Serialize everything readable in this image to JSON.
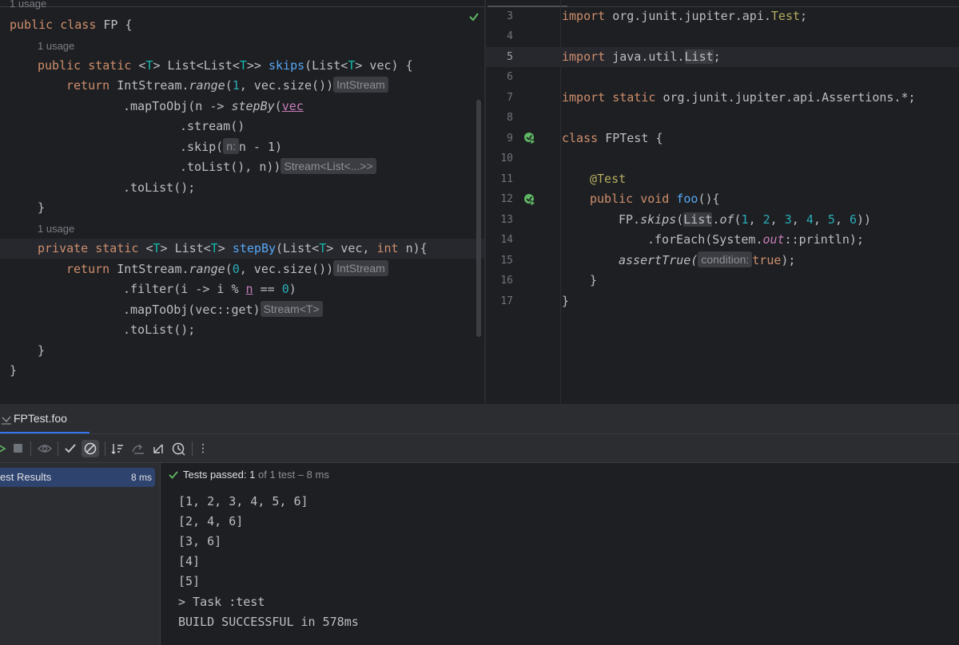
{
  "left_editor": {
    "usage_top": "1 usage",
    "class_line": "public class FP {",
    "usage_skips": "1 usage",
    "skips": {
      "line1": "public static <T> List<List<T>> skips(List<T> vec) {",
      "line2": "return IntStream.range(1, vec.size())",
      "hint2": "IntStream",
      "line3": ".mapToObj(n -> stepBy(vec",
      "line4": ".stream()",
      "line5a": ".skip(",
      "hint5": "n:",
      "line5b": "n - 1)",
      "line6": ".toList(), n))",
      "hint6": "Stream<List<...>>",
      "line7": ".toList();",
      "close": "}"
    },
    "usage_stepby": "1 usage",
    "stepby": {
      "line1": "private static <T> List<T> stepBy(List<T> vec, int n){",
      "line2": "return IntStream.range(0, vec.size())",
      "hint2": "IntStream",
      "line3": ".filter(i -> i % n == 0)",
      "line4": ".mapToObj(vec::get)",
      "hint4": "Stream<T>",
      "line5": ".toList();",
      "close": "}"
    },
    "class_close": "}"
  },
  "right_editor": {
    "line_numbers": [
      "3",
      "4",
      "5",
      "6",
      "7",
      "8",
      "9",
      "10",
      "11",
      "12",
      "13",
      "14",
      "15",
      "16",
      "17"
    ],
    "current_line": "5",
    "lines": {
      "l3": "import org.junit.jupiter.api.Test;",
      "l5": "import java.util.List;",
      "l7": "import static org.junit.jupiter.api.Assertions.*;",
      "l9": "class FPTest {",
      "l11": "@Test",
      "l12": "public void foo(){",
      "l13": "FP.skips(List.of(1, 2, 3, 4, 5, 6))",
      "l14": ".forEach(System.out::println);",
      "l15a": "assertTrue(",
      "l15_hint": "condition:",
      "l15b": "true);",
      "l16": "}",
      "l17": "}"
    }
  },
  "run_panel": {
    "tab_title": "FPTest.foo",
    "tree": {
      "item_label": "est Results",
      "item_time": "8 ms"
    },
    "status": {
      "prefix": "Tests passed:",
      "count": "1",
      "suffix": "of 1 test – 8 ms"
    },
    "output": [
      "[1, 2, 3, 4, 5, 6]",
      "[2, 4, 6]",
      "[3, 6]",
      "[4]",
      "[5]",
      "> Task :test",
      "BUILD SUCCESSFUL in 578ms"
    ]
  },
  "colors": {
    "keyword": "#cf8e6d",
    "function": "#56a8f5",
    "type_param": "#16baac",
    "number": "#2aacb8",
    "accent": "#3574f0",
    "pass_green": "#5fb865"
  },
  "icons": [
    "check-icon",
    "run-test-icon",
    "rerun-icon",
    "stop-icon",
    "eye-icon",
    "show-passed-icon",
    "show-ignored-icon",
    "sort-icon",
    "import-icon",
    "export-icon",
    "history-icon",
    "more-icon"
  ]
}
